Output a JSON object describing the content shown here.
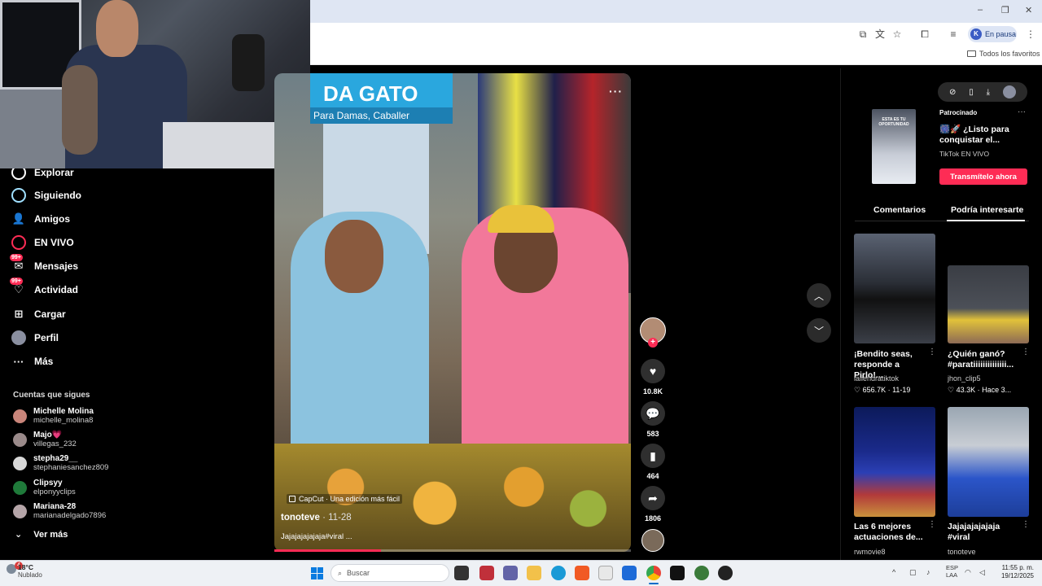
{
  "browser": {
    "profile_initial": "K",
    "profile_status": "En pausa",
    "bookmarks_label": "Todos los favoritos",
    "window_controls": [
      "–",
      "❐",
      "✕"
    ],
    "toolbar_icons": [
      "install-app-icon",
      "translate-icon",
      "star-icon",
      "extensions-icon",
      "reading-list-icon"
    ]
  },
  "sidebar": {
    "items": [
      {
        "label": "Explorar",
        "icon": "compass-icon"
      },
      {
        "label": "Siguiendo",
        "icon": "following-icon"
      },
      {
        "label": "Amigos",
        "icon": "friends-icon"
      },
      {
        "label": "EN VIVO",
        "icon": "live-icon"
      },
      {
        "label": "Mensajes",
        "icon": "messages-icon",
        "badge": "99+"
      },
      {
        "label": "Actividad",
        "icon": "activity-icon",
        "badge": "99+"
      },
      {
        "label": "Cargar",
        "icon": "upload-icon"
      },
      {
        "label": "Perfil",
        "icon": "profile-icon"
      },
      {
        "label": "Más",
        "icon": "more-icon"
      }
    ],
    "following_title": "Cuentas que sigues",
    "following": [
      {
        "name": "Michelle Molina",
        "user": "michelle_molina8"
      },
      {
        "name": "Majo💗",
        "user": "villegas_232"
      },
      {
        "name": "stepha29__",
        "user": "stephaniesanchez809"
      },
      {
        "name": "Clipsyy",
        "user": "elponyyclips"
      },
      {
        "name": "Mariana-28",
        "user": "marianadelgado7896"
      }
    ],
    "see_more": "Ver más"
  },
  "video": {
    "sign_text": "DA GATO",
    "sign_sub": "Para Damas, Caballer",
    "capcut": "CapCut · Una edición más fácil",
    "author": "tonoteve",
    "date": " · 11-28",
    "description": "Jajajajajajaja#viral ...",
    "progress": 0.3
  },
  "actions": {
    "likes": "10.8K",
    "comments": "583",
    "saves": "464",
    "shares": "1806"
  },
  "right_panel": {
    "ad": {
      "sponsored": "Patrocinado",
      "thumb_text": "ESTA ES TU OPORTUNIDAD",
      "title": "🎆🚀 ¿Listo para conquistar el...",
      "subtitle": "TikTok EN VIVO",
      "cta": "Transmítelo ahora"
    },
    "tabs": [
      "Comentarios",
      "Podría interesarte"
    ],
    "cards": [
      {
        "title": "¡Bendito seas, responde a Pirlo!...",
        "user": "laliendratiktok",
        "meta": "♡ 656.7K · 11-19"
      },
      {
        "title": "¿Quién ganó? #paratiiiiiiiiiiiiii...",
        "user": "jhon_clip5",
        "meta": "♡ 43.3K · Hace 3..."
      },
      {
        "title": "Las 6 mejores actuaciones de...",
        "user": "rwmovie8",
        "meta": ""
      },
      {
        "title": "Jajajajajajaja #viral",
        "user": "tonoteve",
        "meta": ""
      }
    ]
  },
  "taskbar": {
    "weather_badge": "4",
    "temp": "18°C",
    "weather": "Nublado",
    "search_placeholder": "Buscar",
    "lang_line1": "ESP",
    "lang_line2": "LAA",
    "time": "11:55 p. m.",
    "date": "19/12/2025"
  },
  "colors": {
    "accent": "#fe2c55",
    "background": "#000000"
  }
}
